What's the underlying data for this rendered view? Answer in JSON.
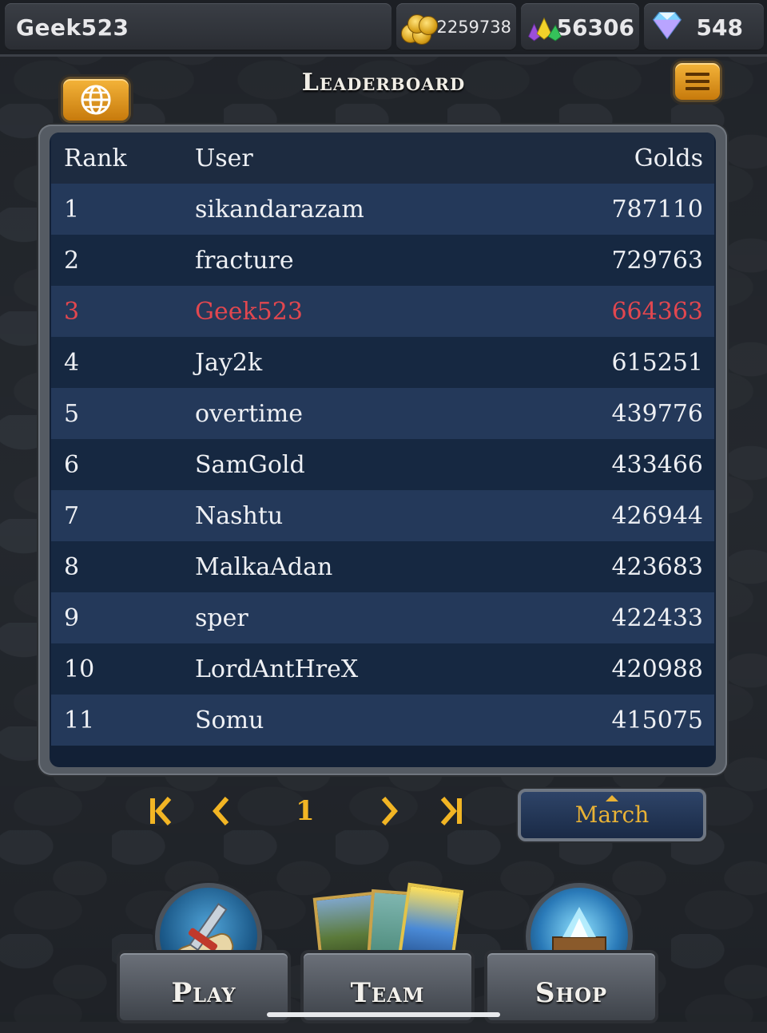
{
  "topbar": {
    "username": "Geek523",
    "gold": "2259738",
    "gems": "56306",
    "diamonds": "548"
  },
  "header": {
    "title": "Leaderboard",
    "globe_icon": "globe-icon",
    "menu_icon": "hamburger-menu-icon"
  },
  "leaderboard": {
    "columns": [
      "Rank",
      "User",
      "Golds"
    ],
    "rows": [
      {
        "rank": "1",
        "user": "sikandarazam",
        "golds": "787110"
      },
      {
        "rank": "2",
        "user": "fracture",
        "golds": "729763"
      },
      {
        "rank": "3",
        "user": "Geek523",
        "golds": "664363"
      },
      {
        "rank": "4",
        "user": "Jay2k",
        "golds": "615251"
      },
      {
        "rank": "5",
        "user": "overtime",
        "golds": "439776"
      },
      {
        "rank": "6",
        "user": "SamGold",
        "golds": "433466"
      },
      {
        "rank": "7",
        "user": "Nashtu",
        "golds": "426944"
      },
      {
        "rank": "8",
        "user": "MalkaAdan",
        "golds": "423683"
      },
      {
        "rank": "9",
        "user": "sper",
        "golds": "422433"
      },
      {
        "rank": "10",
        "user": "LordAntHreX",
        "golds": "420988"
      },
      {
        "rank": "11",
        "user": "Somu",
        "golds": "415075"
      }
    ],
    "highlight_color": "#e2474f"
  },
  "pagination": {
    "first": "K",
    "prev": "<",
    "page": "1",
    "next": ">",
    "last": "K",
    "month": "March"
  },
  "nav": {
    "play": "Play",
    "team": "Team",
    "shop": "Shop"
  }
}
